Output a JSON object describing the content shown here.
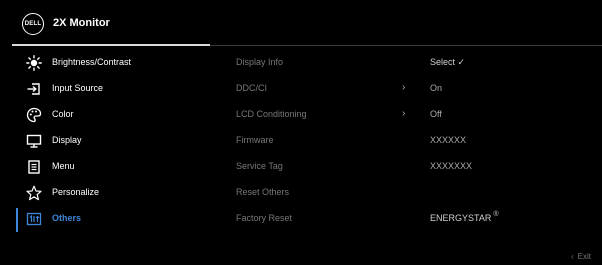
{
  "header": {
    "logo_text": "DELL",
    "title": "2X Monitor"
  },
  "menu": {
    "items": [
      {
        "label": "Brightness/Contrast",
        "icon": "brightness-icon"
      },
      {
        "label": "Input Source",
        "icon": "input-source-icon"
      },
      {
        "label": "Color",
        "icon": "color-palette-icon"
      },
      {
        "label": "Display",
        "icon": "display-monitor-icon"
      },
      {
        "label": "Menu",
        "icon": "menu-list-icon"
      },
      {
        "label": "Personalize",
        "icon": "star-icon"
      },
      {
        "label": "Others",
        "icon": "others-icon"
      }
    ],
    "active": "Others"
  },
  "submenu": {
    "rows": [
      {
        "name": "Display Info",
        "arrow": "",
        "value": "Select ✓"
      },
      {
        "name": "DDC/CI",
        "arrow": "›",
        "value": "On"
      },
      {
        "name": "LCD Conditioning",
        "arrow": "›",
        "value": "Off"
      },
      {
        "name": "Firmware",
        "arrow": "",
        "value": "XXXXXX"
      },
      {
        "name": "Service Tag",
        "arrow": "",
        "value": "XXXXXXX"
      },
      {
        "name": "Reset Others",
        "arrow": "",
        "value": ""
      },
      {
        "name": "Factory Reset",
        "arrow": "",
        "value": "ENERGYSTAR",
        "value_mark": "®"
      }
    ]
  },
  "footer": {
    "exit_chevron": "‹",
    "exit_label": "Exit"
  },
  "colors": {
    "background": "#000000",
    "accent": "#3d86d8",
    "text": "#ffffff",
    "dim_text": "#777777"
  }
}
